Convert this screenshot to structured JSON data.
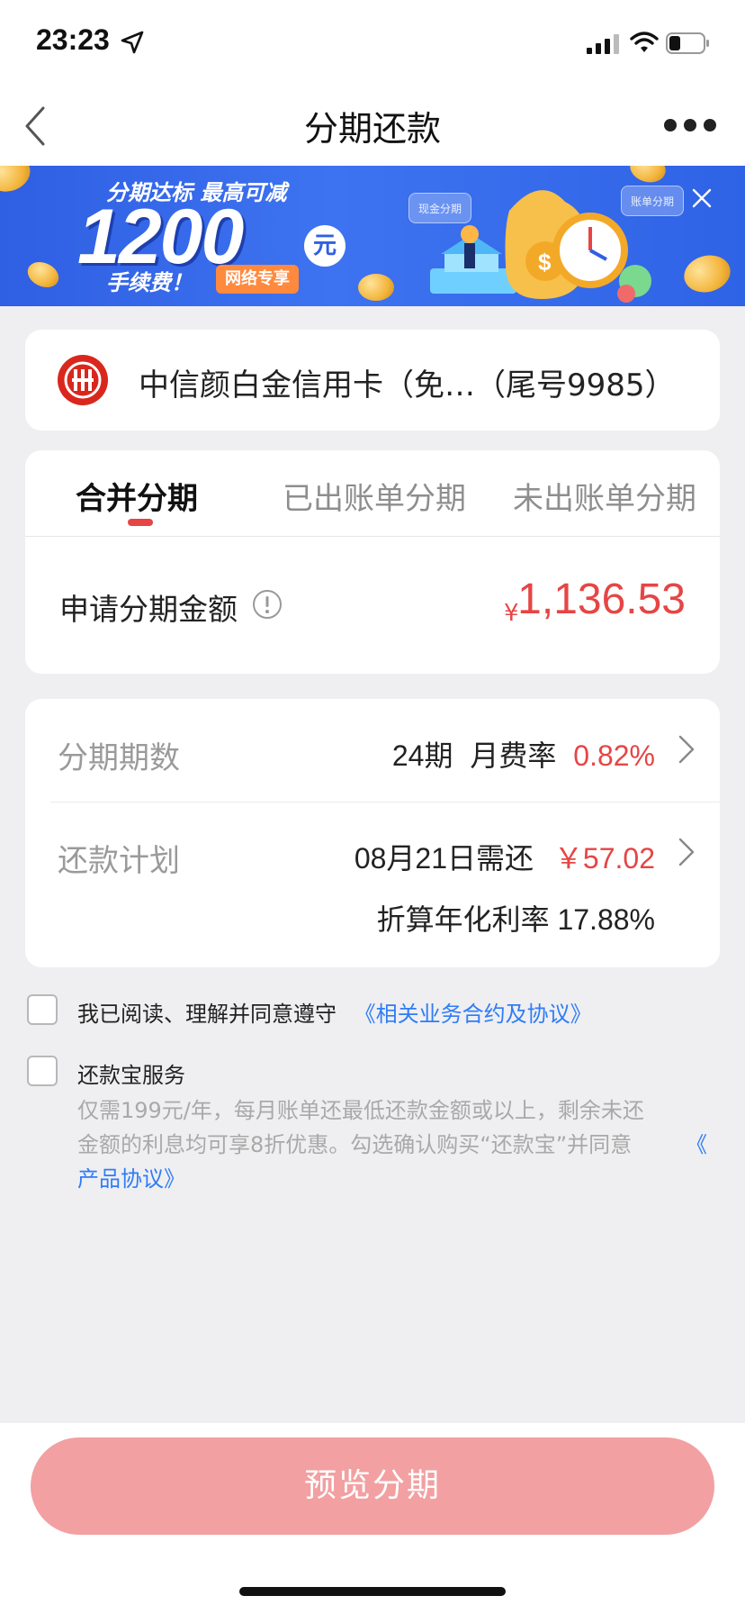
{
  "status_bar": {
    "time": "23:23"
  },
  "nav": {
    "title": "分期还款"
  },
  "banner": {
    "line1": "分期达标  最高可减",
    "amount": "1200",
    "unit": "元",
    "line3": "手续费！",
    "tag": "网络专享",
    "chip_left": "现金分期",
    "chip_right": "账单分期"
  },
  "card": {
    "name": "中信颜白金信用卡（免…（尾号9985）"
  },
  "tabs": [
    {
      "label": "合并分期"
    },
    {
      "label": "已出账单分期"
    },
    {
      "label": "未出账单分期"
    }
  ],
  "amount": {
    "label": "申请分期金额",
    "currency": "¥",
    "value": "1,136.53"
  },
  "plan": {
    "periods_label": "分期期数",
    "periods_value": "24期",
    "rate_label": "月费率",
    "rate_value": "0.82%",
    "schedule_label": "还款计划",
    "due_text": "08月21日需还",
    "due_amount": "￥57.02",
    "apr_text": "折算年化利率 17.88%"
  },
  "agreement": {
    "text": "我已阅读、理解并同意遵守",
    "link": "《相关业务合约及协议》"
  },
  "service": {
    "title": "还款宝服务",
    "desc_line1": "仅需199元/年，每月账单还最低还款金额或以上，剩余未还",
    "desc_line2": "金额的利息均可享8折优惠。勾选确认购买“还款宝”并同意",
    "desc_link_part1": "《",
    "desc_link_part2": "产品协议》"
  },
  "footer": {
    "button_label": "预览分期"
  },
  "colors": {
    "accent_red": "#e64545",
    "link_blue": "#2f7cf6",
    "button": "#f2a0a2"
  }
}
